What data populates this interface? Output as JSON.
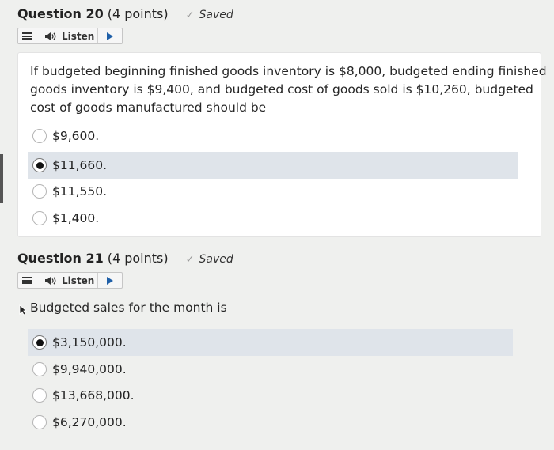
{
  "q20": {
    "title": "Question 20",
    "points": "(4 points)",
    "saved": "Saved",
    "listen_label": "Listen",
    "text_lines": [
      "If budgeted beginning finished goods inventory is $8,000, budgeted ending finished",
      "goods inventory is $9,400, and budgeted cost of goods sold is $10,260, budgeted",
      "cost of goods manufactured should be"
    ],
    "options": [
      "$9,600.",
      "$11,660.",
      "$11,550.",
      "$1,400."
    ],
    "selected_index": 1
  },
  "q21": {
    "title": "Question 21",
    "points": "(4 points)",
    "saved": "Saved",
    "listen_label": "Listen",
    "text": "Budgeted sales for the month is",
    "options": [
      "$3,150,000.",
      "$9,940,000.",
      "$13,668,000.",
      "$6,270,000."
    ],
    "selected_index": 0
  },
  "icons": {
    "saved_icon": "checkmark-icon",
    "menu_icon": "hamburger-menu-icon",
    "speaker_icon": "speaker-icon",
    "play_icon": "play-icon"
  },
  "colors": {
    "selected_row": "#dfe4ea",
    "play_arrow": "#1f5fa8"
  }
}
